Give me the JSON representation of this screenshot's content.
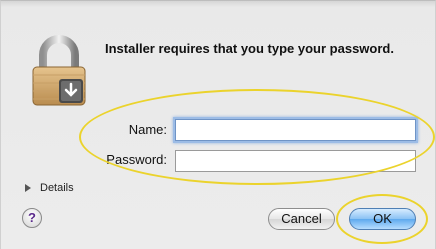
{
  "dialog": {
    "message": "Installer requires that you type your password.",
    "name_label": "Name:",
    "name_value": "",
    "password_label": "Password:",
    "password_value": "",
    "details_label": "Details",
    "help_label": "?",
    "cancel_label": "Cancel",
    "ok_label": "OK"
  },
  "icons": {
    "lock": "lock-icon",
    "disclosure": "disclosure-triangle-icon",
    "help": "help-icon"
  },
  "colors": {
    "annotation_circle": "#ebd32c",
    "ok_button": "#5ea9ee",
    "focus_ring": "#9cbce6"
  }
}
